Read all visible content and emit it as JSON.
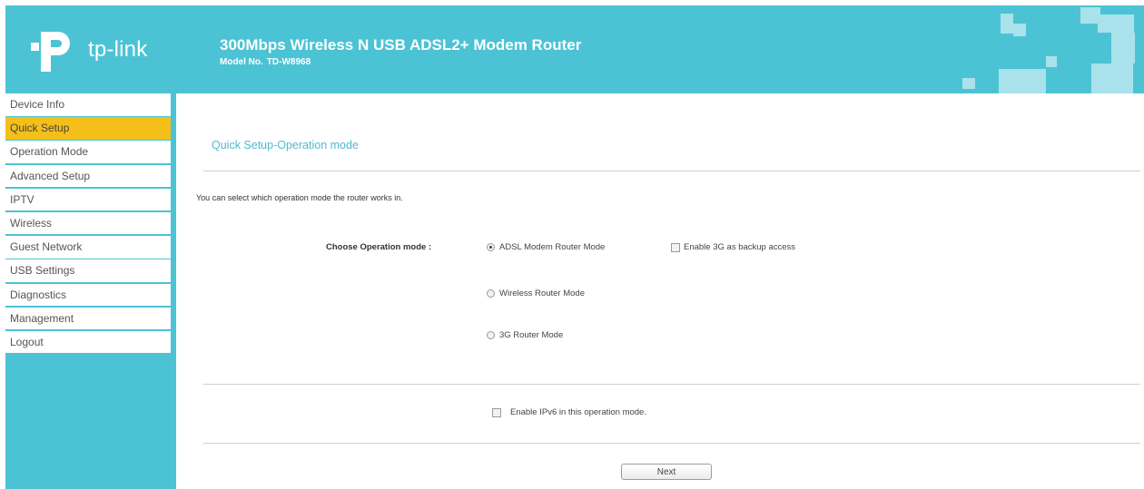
{
  "brand": {
    "logo_text": "tp-link"
  },
  "header": {
    "product_title": "300Mbps Wireless N USB ADSL2+ Modem Router",
    "model_label": "Model No.",
    "model_number": "TD-W8968"
  },
  "sidebar": {
    "items": [
      {
        "label": "Device Info"
      },
      {
        "label": "Quick Setup",
        "active": true
      },
      {
        "label": "Operation Mode"
      },
      {
        "label": "Advanced Setup"
      },
      {
        "label": "IPTV"
      },
      {
        "label": "Wireless"
      },
      {
        "label": "Guest Network"
      },
      {
        "label": "USB Settings"
      },
      {
        "label": "Diagnostics"
      },
      {
        "label": "Management"
      },
      {
        "label": "Logout"
      }
    ]
  },
  "main": {
    "section_title": "Quick Setup-Operation mode",
    "description": "You can select which operation mode the router works in.",
    "choose_label": "Choose Operation mode :",
    "modes": [
      {
        "label": "ADSL Modem Router Mode",
        "selected": true
      },
      {
        "label": "Wireless Router Mode",
        "selected": false
      },
      {
        "label": "3G Router Mode",
        "selected": false
      }
    ],
    "backup_checkbox_label": "Enable 3G as backup access",
    "ipv6_checkbox_label": "Enable IPv6 in this operation mode.",
    "next_label": "Next"
  },
  "colors": {
    "brand_teal": "#4cc3d4",
    "active_menu": "#f5bf19",
    "section_title": "#53b9cd"
  }
}
